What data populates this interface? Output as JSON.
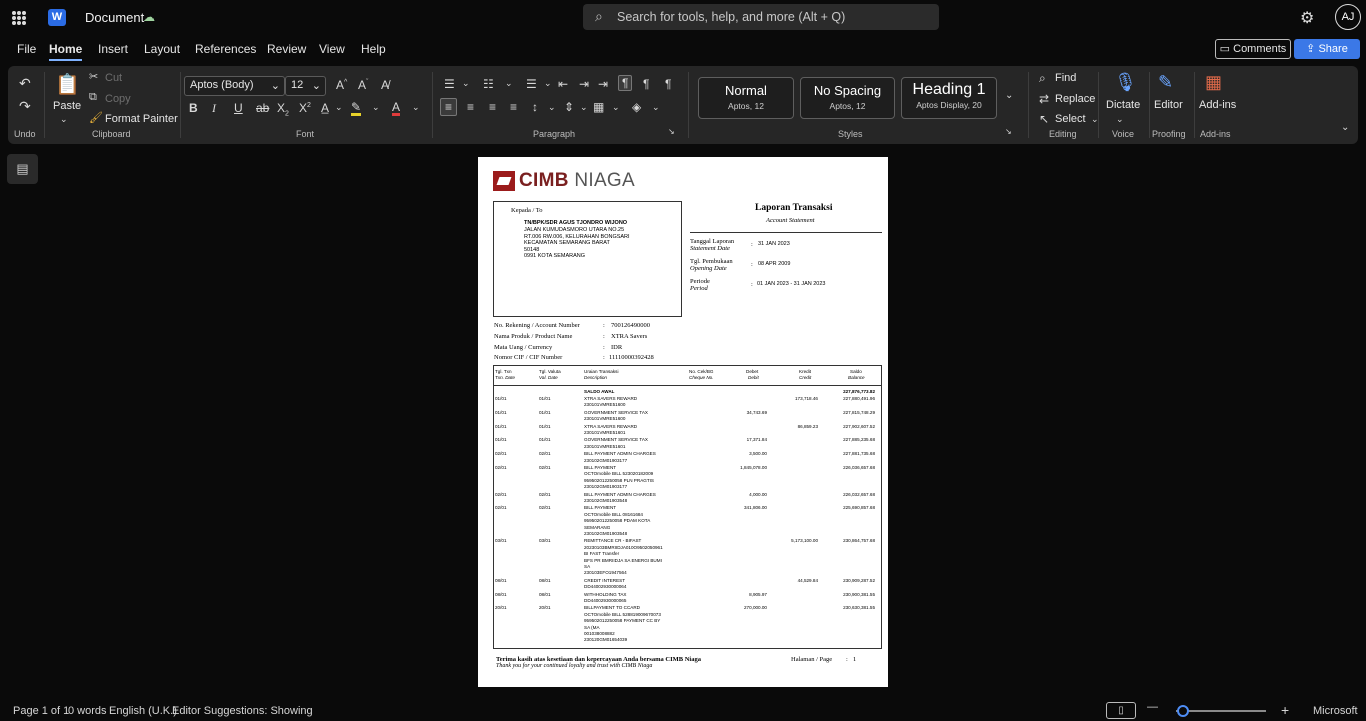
{
  "titlebar": {
    "doc_title": "Document",
    "search_placeholder": "Search for tools, help, and more (Alt + Q)",
    "user_initials": "AJ"
  },
  "menu": {
    "items": [
      "File",
      "Home",
      "Insert",
      "Layout",
      "References",
      "Review",
      "View",
      "Help"
    ],
    "active": "Home",
    "comments": "Comments",
    "share": "Share"
  },
  "ribbon": {
    "undo_group": "Undo",
    "clipboard": {
      "paste": "Paste",
      "cut": "Cut",
      "copy": "Copy",
      "format_painter": "Format Painter",
      "label": "Clipboard"
    },
    "font": {
      "name": "Aptos (Body)",
      "size": "12",
      "label": "Font"
    },
    "paragraph": {
      "label": "Paragraph"
    },
    "styles": {
      "label": "Styles",
      "items": [
        {
          "name": "Normal",
          "desc": "Aptos, 12"
        },
        {
          "name": "No Spacing",
          "desc": "Aptos, 12"
        },
        {
          "name": "Heading 1",
          "desc": "Aptos Display, 20"
        }
      ]
    },
    "editing": {
      "find": "Find",
      "replace": "Replace",
      "select": "Select",
      "label": "Editing"
    },
    "voice": {
      "dictate": "Dictate",
      "label": "Voice"
    },
    "proofing": {
      "editor": "Editor",
      "label": "Proofing"
    },
    "addins": {
      "addins": "Add-ins",
      "label": "Add-ins"
    }
  },
  "statement": {
    "bank_name_1": "CIMB",
    "bank_name_2": "NIAGA",
    "to_label": "Kepada / To",
    "address_lines": [
      "TN/BPK/SDR AGUS TJONDRO WIJONO",
      "JALAN KUMUDASMORO UTARA NO.25",
      "RT.006 RW.006, KELURAHAN BONGSARI",
      "KECAMATAN SEMARANG BARAT",
      "50148",
      "0991 KOTA SEMARANG"
    ],
    "title": "Laporan Transaksi",
    "subtitle": "Account Statement",
    "report_date_label": "Tanggal Laporan",
    "report_date_label_en": "Statement Date",
    "report_date": "31 JAN 2023",
    "open_date_label": "Tgl. Pembukaan",
    "open_date_label_en": "Opening Date",
    "open_date": "08 APR 2009",
    "period_label": "Periode",
    "period_label_en": "Period",
    "period": "01 JAN 2023 - 31 JAN 2023",
    "acct_label": "No. Rekening / Account Number",
    "acct": "700126490000",
    "product_label": "Nama Produk / Product Name",
    "product": "XTRA Savers",
    "currency_label": "Mata Uang / Currency",
    "currency": "IDR",
    "cif_label": "Nomor CIF / CIF Number",
    "cif": "11110000392428",
    "columns": [
      {
        "id": "Tgl. Txn",
        "en": "Txn. Date"
      },
      {
        "id": "Tgl. Valuta",
        "en": "Val. Date"
      },
      {
        "id": "Uraian Transaksi",
        "en": "Description"
      },
      {
        "id": "No. Cek/BG",
        "en": "Cheque No."
      },
      {
        "id": "Debet",
        "en": "Debit"
      },
      {
        "id": "Kredit",
        "en": "Credit"
      },
      {
        "id": "Saldo",
        "en": "Balance"
      }
    ],
    "opening_label": "SALDO AWAL",
    "opening_balance": "227,876,773.82",
    "transactions": [
      {
        "txn": "01/01",
        "val": "01/01",
        "desc": [
          "XTRA SAVERS REWARD",
          "230101VMRE51600"
        ],
        "debit": "",
        "credit": "173,718.46",
        "balance": "227,880,491.96"
      },
      {
        "txn": "01/01",
        "val": "01/01",
        "desc": [
          "GOVERNMENT SERVICE TAX",
          "230101VMRE51600"
        ],
        "debit": "34,743.69",
        "credit": "",
        "balance": "227,815,748.29"
      },
      {
        "txn": "01/01",
        "val": "01/01",
        "desc": [
          "XTRA SAVERS REWARD",
          "230101VMRE51601"
        ],
        "debit": "",
        "credit": "86,859.23",
        "balance": "227,902,607.52"
      },
      {
        "txn": "01/01",
        "val": "01/01",
        "desc": [
          "GOVERNMENT SERVICE TAX",
          "230101VMRE51601"
        ],
        "debit": "17,371.84",
        "credit": "",
        "balance": "227,885,235.68"
      },
      {
        "txn": "02/01",
        "val": "02/01",
        "desc": [
          "BILL PAYMENT ADMIN CHARGES",
          "230102GM01903177"
        ],
        "debit": "3,500.00",
        "credit": "",
        "balance": "227,881,735.68"
      },
      {
        "txn": "02/01",
        "val": "02/01",
        "desc": [
          "BILL PAYMENT",
          "OCTOmobile BILL 523020182009",
          "959502012250058 PLN PRAGTIS",
          "230102GM01903177"
        ],
        "debit": "1,845,078.00",
        "credit": "",
        "balance": "226,036,657.68"
      },
      {
        "txn": "02/01",
        "val": "02/01",
        "desc": [
          "BILL PAYMENT ADMIN CHARGES",
          "230102GM01903548"
        ],
        "debit": "4,000.00",
        "credit": "",
        "balance": "226,032,657.68"
      },
      {
        "txn": "02/01",
        "val": "02/01",
        "desc": [
          "BILL PAYMENT",
          "OCTOmobile BILL 08161684",
          "959502012250058 PDAM KOTA",
          "SEMARANG",
          "230102GM01903548"
        ],
        "debit": "341,806.00",
        "credit": "",
        "balance": "225,690,857.68"
      },
      {
        "txn": "03/01",
        "val": "03/01",
        "desc": [
          "REMITTANCE CR - BIFAST",
          "20230103BMRIIDJA010O9502050961",
          "BI FAST Transfer",
          "BFS  PR BMRIIDJA SA ENERGI BUMI",
          "SA",
          "230103EFO1947564"
        ],
        "debit": "",
        "credit": "5,173,100.00",
        "balance": "230,864,757.68"
      },
      {
        "txn": "08/01",
        "val": "08/01",
        "desc": [
          "CREDIT INTEREST",
          "DD44002930000064"
        ],
        "debit": "",
        "credit": "44,529.84",
        "balance": "230,909,287.52"
      },
      {
        "txn": "08/01",
        "val": "08/01",
        "desc": [
          "WITHHOLDING TAX",
          "DD44002930000065"
        ],
        "debit": "8,905.97",
        "credit": "",
        "balance": "230,900,381.55"
      },
      {
        "txn": "20/01",
        "val": "20/01",
        "desc": [
          "BILLPAYMENT TO CCARD",
          "OCTOmobile BILL 528819009670073",
          "959502012250058 PAYMENT CC BY",
          "SA (MA",
          "001038008882",
          "230120GM01654039"
        ],
        "debit": "270,000.00",
        "credit": "",
        "balance": "230,630,381.55"
      }
    ],
    "footer_thanks": "Terima kasih atas kesetiaan dan kepercayaan Anda bersama CIMB Niaga",
    "footer_thanks_en": "Thank you for your continued loyalty and trust with CIMB Niaga",
    "page_label": "Halaman / Page",
    "page_no": "1"
  },
  "status": {
    "page": "Page 1 of 1",
    "words": "0 words",
    "language": "English (U.K.)",
    "suggestions": "Editor Suggestions: Showing",
    "zoom_minus": "—",
    "zoom_plus": "+",
    "microsoft": "Microsoft"
  }
}
